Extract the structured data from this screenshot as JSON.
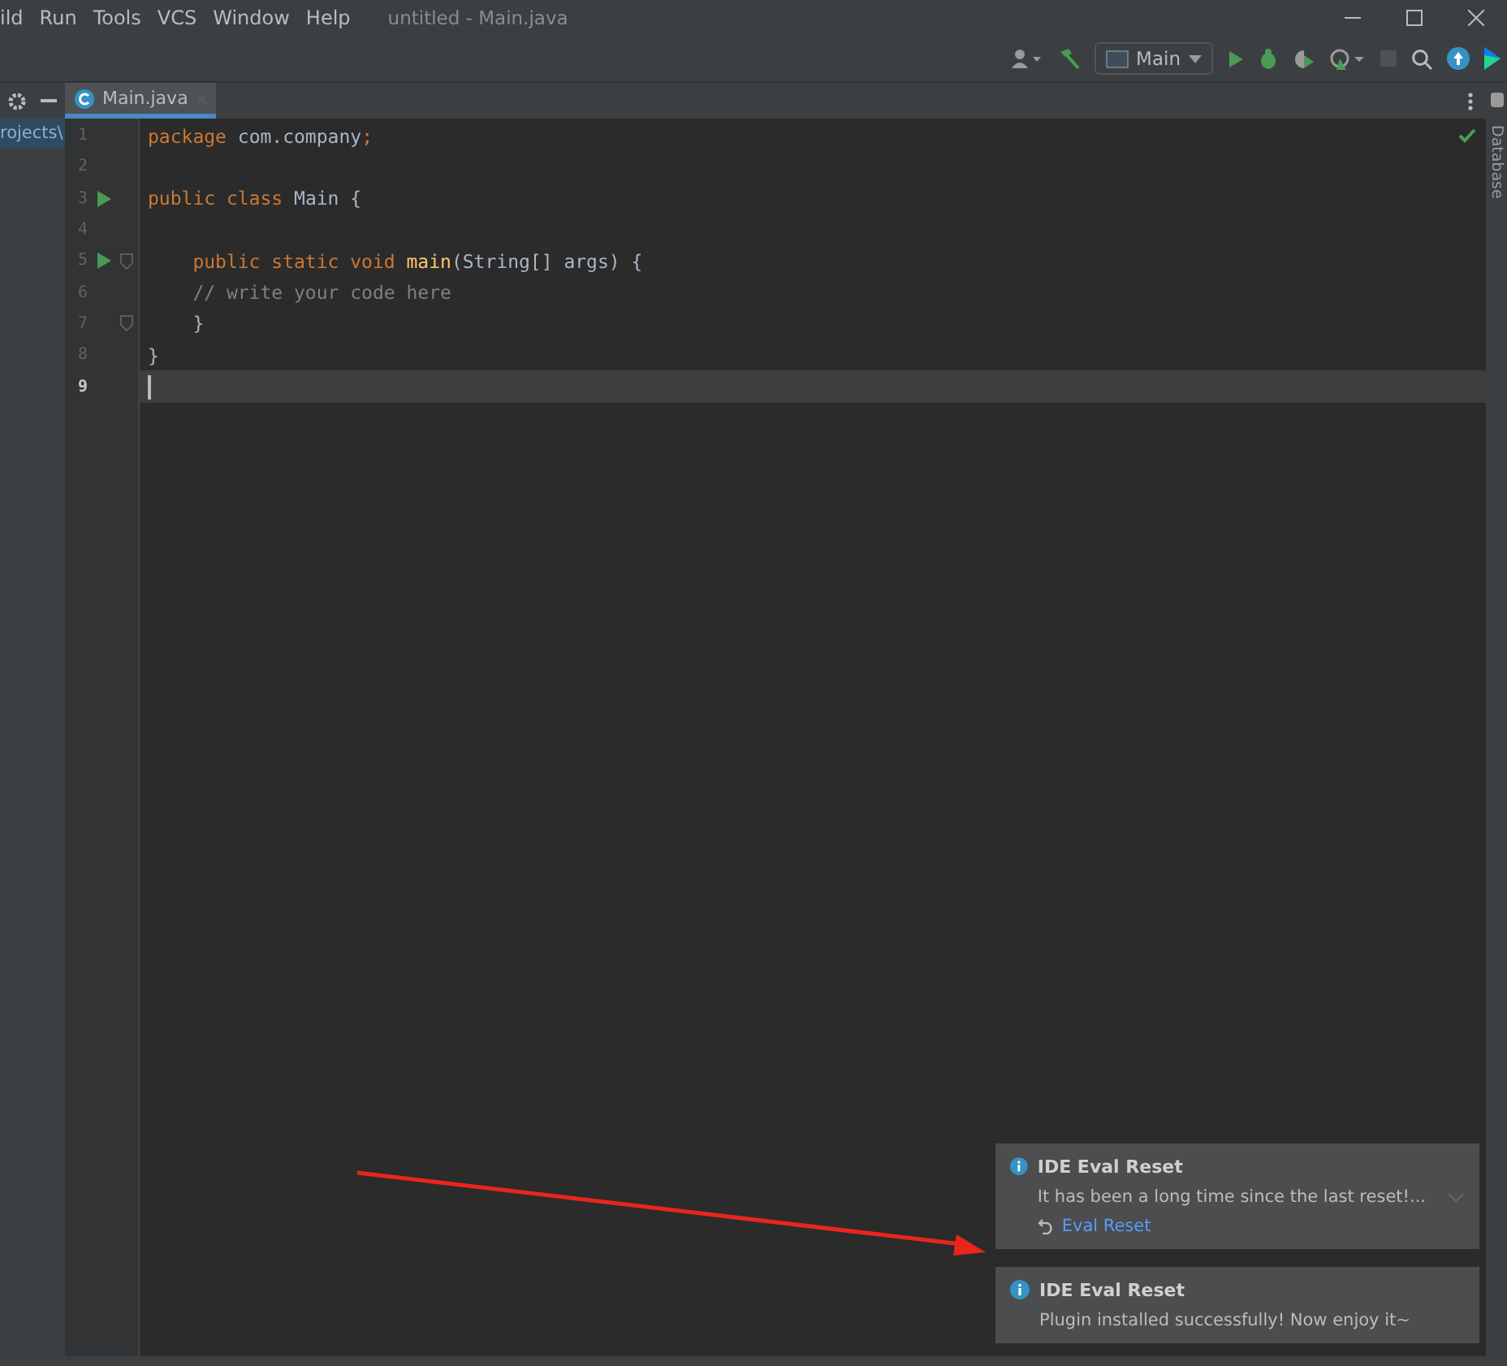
{
  "menu": [
    "ild",
    "Run",
    "Tools",
    "VCS",
    "Window",
    "Help"
  ],
  "window": {
    "title": "untitled - Main.java"
  },
  "toolbar": {
    "run_config": "Main"
  },
  "tabs": [
    {
      "label": "Main.java",
      "selected": true
    }
  ],
  "project_panel": {
    "path": "rojects\\"
  },
  "editor": {
    "lines": [
      {
        "number": "1",
        "run": false,
        "fold": false,
        "current": false,
        "tokens": [
          {
            "text": "package ",
            "kind": "keyword"
          },
          {
            "text": "com.company",
            "kind": "plain"
          },
          {
            "text": ";",
            "kind": "keyword"
          }
        ]
      },
      {
        "number": "2",
        "run": false,
        "fold": false,
        "current": false
      },
      {
        "number": "3",
        "run": true,
        "fold": false,
        "current": false,
        "tokens": [
          {
            "text": "public class ",
            "kind": "keyword"
          },
          {
            "text": "Main {",
            "kind": "plain"
          }
        ]
      },
      {
        "number": "4",
        "run": false,
        "fold": false,
        "current": false
      },
      {
        "number": "5",
        "run": true,
        "fold": true,
        "current": false,
        "tokens": [
          {
            "text": "    public static void ",
            "kind": "keyword"
          },
          {
            "text": "main",
            "kind": "method"
          },
          {
            "text": "(String[] args) {",
            "kind": "plain"
          }
        ]
      },
      {
        "number": "6",
        "run": false,
        "fold": false,
        "current": false,
        "tokens": [
          {
            "text": "    // write your code here",
            "kind": "comment"
          }
        ]
      },
      {
        "number": "7",
        "run": false,
        "fold": true,
        "current": false,
        "tokens": [
          {
            "text": "    }",
            "kind": "plain"
          }
        ]
      },
      {
        "number": "8",
        "run": false,
        "fold": false,
        "current": false,
        "tokens": [
          {
            "text": "}",
            "kind": "plain"
          }
        ]
      },
      {
        "number": "9",
        "run": false,
        "fold": false,
        "current": true
      }
    ]
  },
  "right_strip": {
    "label": "Database"
  },
  "notifications": [
    {
      "title": "IDE Eval Reset",
      "message": "It has been a long time since the last reset!...",
      "action": "Eval Reset"
    },
    {
      "title": "IDE Eval Reset",
      "message": "Plugin installed successfully! Now enjoy it~"
    }
  ]
}
